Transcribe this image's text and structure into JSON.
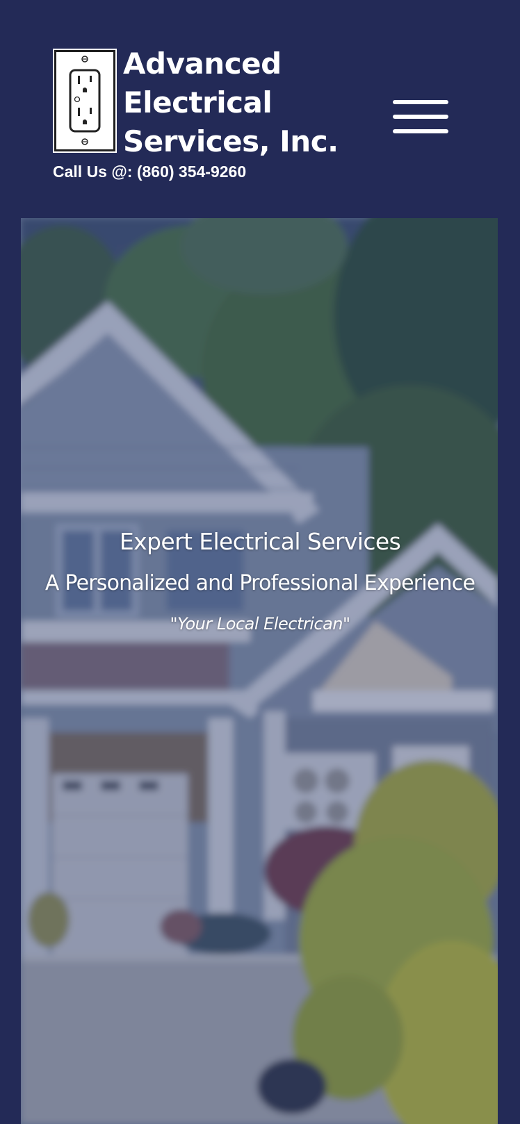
{
  "header": {
    "brand_line1": "Advanced",
    "brand_line2": "Electrical",
    "brand_line3": "Services, Inc.",
    "phone_text": "Call Us @: (860) 354-9260",
    "logo_icon": "electrical-outlet-icon",
    "menu_icon": "hamburger-menu-icon"
  },
  "hero": {
    "headline": "Expert Electrical Services",
    "subheadline": "A Personalized and Professional Experience",
    "tagline": "\"Your Local Electrican\""
  },
  "colors": {
    "header_bg": "#232a57",
    "text": "#ffffff"
  }
}
